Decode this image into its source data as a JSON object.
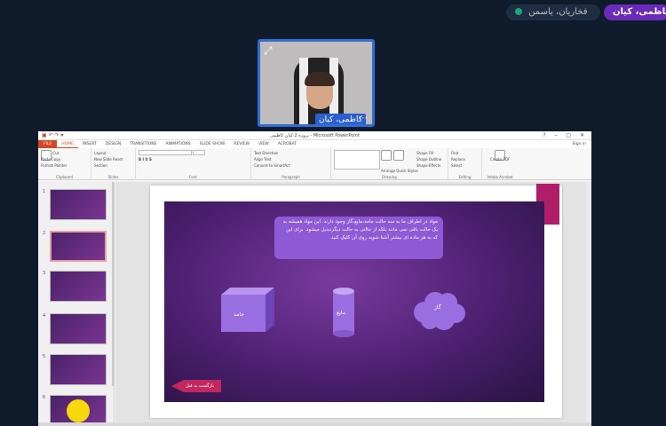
{
  "participants": {
    "self_name": "کاظمی، کیان",
    "other_name": "فخاریان، یاسمن"
  },
  "webcam": {
    "name_label": "کاظمی، کیان",
    "expand_glyph": "⤢",
    "more_glyph": "⋯"
  },
  "powerpoint": {
    "window_title": "پروژه 2 کیان کاظمی - Microsoft PowerPoint",
    "quick_access": "▣ ↶ ↷ ▾",
    "window_controls": "? – ▢ ✕",
    "tabs": {
      "file": "FILE",
      "home": "HOME",
      "insert": "INSERT",
      "design": "DESIGN",
      "transitions": "TRANSITIONS",
      "animations": "ANIMATIONS",
      "slideshow": "SLIDE SHOW",
      "review": "REVIEW",
      "view": "VIEW",
      "acrobat": "ACROBAT"
    },
    "sign_in": "Sign in",
    "ribbon": {
      "clipboard": {
        "label": "Clipboard",
        "paste": "Paste",
        "cut": "Cut",
        "copy": "Copy",
        "format_painter": "Format Painter"
      },
      "slides": {
        "label": "Slides",
        "new_slide": "New Slide",
        "layout": "Layout",
        "reset": "Reset",
        "section": "Section"
      },
      "font": {
        "label": "Font"
      },
      "paragraph": {
        "label": "Paragraph",
        "text_direction": "Text Direction",
        "align_text": "Align Text",
        "convert_smartart": "Convert to SmartArt"
      },
      "drawing": {
        "label": "Drawing",
        "arrange": "Arrange",
        "quick_styles": "Quick Styles",
        "shape_fill": "Shape Fill",
        "shape_outline": "Shape Outline",
        "shape_effects": "Shape Effects"
      },
      "editing": {
        "label": "Editing",
        "find": "Find",
        "replace": "Replace",
        "select": "Select"
      },
      "adobe": {
        "label": "Adobe Acrobat",
        "create_pdf": "Create PDF"
      }
    },
    "thumbnail_numbers": [
      "1",
      "2",
      "3",
      "4",
      "5",
      "6"
    ],
    "slide": {
      "text": "مواد در اطراف ما به سه حالت جامد،مایع،گاز وجود دارند. این مواد همیشه به یک حالت باقی نمی مانند بلکه از حالتی به حالت دیگرتبدیل میشود. برای این که به هر ماده ای بیشتر آشنا شوید روی آن کلیک کنید.",
      "solid_label": "جامد",
      "liquid_label": "مایع",
      "gas_label": "گاز",
      "back_button": "بازگشت به قبل"
    }
  }
}
